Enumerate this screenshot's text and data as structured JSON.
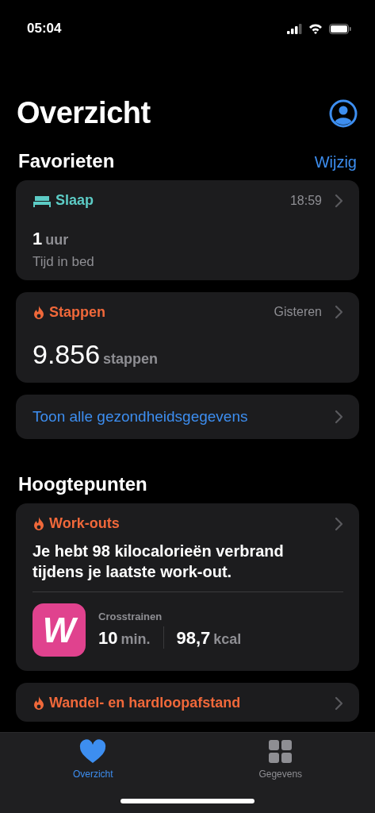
{
  "status_bar": {
    "time": "05:04"
  },
  "title": "Overzicht",
  "favorites": {
    "heading": "Favorieten",
    "action": "Wijzig",
    "cards": [
      {
        "kind": "bed",
        "color": "#5ccbc5",
        "label": "Slaap",
        "meta": "18:59",
        "value": "1",
        "unit": "uur",
        "caption": "Tijd in bed"
      },
      {
        "kind": "flame",
        "color": "#f0683a",
        "label": "Stappen",
        "meta": "Gisteren",
        "value": "9.856",
        "unit": "stappen"
      }
    ],
    "show_all": "Toon alle gezondheidsgegevens"
  },
  "highlights": {
    "heading": "Hoogtepunten",
    "cards": [
      {
        "kind": "flame",
        "color": "#f0683a",
        "label": "Work-outs",
        "text": "Je hebt 98 kilocalorieën verbrand tijdens je laatste work-out.",
        "workout": {
          "app_letter": "W",
          "activity": "Crosstrainen",
          "stats": [
            {
              "value": "10",
              "unit": "min."
            },
            {
              "value": "98,7",
              "unit": "kcal"
            }
          ]
        }
      },
      {
        "kind": "flame",
        "color": "#f0683a",
        "label": "Wandel- en hardloopafstand"
      }
    ]
  },
  "tab_bar": [
    {
      "kind": "heart",
      "label": "Overzicht",
      "selected": true
    },
    {
      "kind": "grid",
      "label": "Gegevens",
      "selected": false
    }
  ]
}
